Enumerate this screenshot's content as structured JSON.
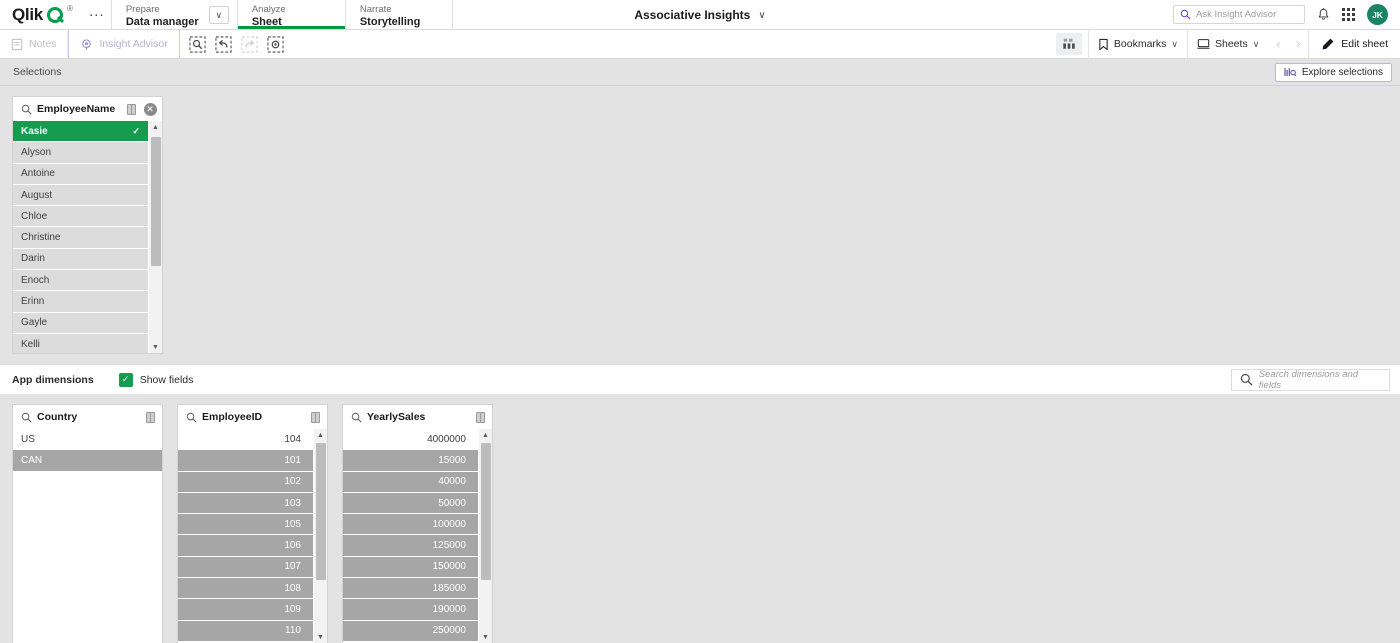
{
  "topbar": {
    "brand": "Qlik",
    "brand_icon": "qlik-logo-icon",
    "overflow_label": "...",
    "tabs": [
      {
        "kicker": "Prepare",
        "title": "Data manager",
        "active": false
      },
      {
        "kicker": "Analyze",
        "title": "Sheet",
        "active": true
      },
      {
        "kicker": "Narrate",
        "title": "Storytelling",
        "active": false
      }
    ],
    "app_title": "Associative Insights",
    "app_title_caret": "∨",
    "search_placeholder": "Ask Insight Advisor",
    "notifications_icon": "bell-icon",
    "apps_icon": "grid-apps-icon",
    "avatar_initials": "JK"
  },
  "toolbar": {
    "notes_label": "Notes",
    "insight_advisor_label": "Insight Advisor",
    "icons": [
      {
        "name": "selection-search-icon",
        "disabled": false
      },
      {
        "name": "step-back-selection-icon",
        "disabled": false
      },
      {
        "name": "step-forward-selection-icon",
        "disabled": true
      },
      {
        "name": "clear-all-selections-icon",
        "disabled": false
      }
    ],
    "data_icon": "data-load-editor-icon",
    "bookmarks_label": "Bookmarks",
    "sheets_label": "Sheets",
    "prev_sheet_icon": "chevron-left-icon",
    "next_sheet_icon": "chevron-right-icon",
    "edit_sheet_label": "Edit sheet",
    "edit_icon": "pencil-icon",
    "caret": "∨"
  },
  "selections_bar": {
    "label": "Selections",
    "explore_label": "Explore selections",
    "explore_icon": "explore-selections-icon"
  },
  "selections": [
    {
      "field": "EmployeeName",
      "search_icon": "search-icon",
      "segment_icon": "listbox-segment-icon",
      "clear_icon": "clear-selection-icon",
      "has_clear": true,
      "align": "left",
      "rows": [
        {
          "value": "Kasie",
          "state": "selected"
        },
        {
          "value": "Alyson",
          "state": "alt"
        },
        {
          "value": "Antoine",
          "state": "alt"
        },
        {
          "value": "August",
          "state": "alt"
        },
        {
          "value": "Chloe",
          "state": "alt"
        },
        {
          "value": "Christine",
          "state": "alt"
        },
        {
          "value": "Darin",
          "state": "alt"
        },
        {
          "value": "Enoch",
          "state": "alt"
        },
        {
          "value": "Erinn",
          "state": "alt"
        },
        {
          "value": "Gayle",
          "state": "alt"
        },
        {
          "value": "Kelli",
          "state": "alt"
        }
      ],
      "scroll": {
        "thumb_top_pct": 2,
        "thumb_height_pct": 62
      }
    }
  ],
  "app_dimensions": {
    "label": "App dimensions",
    "show_fields_label": "Show fields",
    "show_fields_checked": true,
    "check_glyph": "✓",
    "search_placeholder": "Search dimensions and fields",
    "search_icon": "search-icon"
  },
  "fields": [
    {
      "field": "Country",
      "search_icon": "search-icon",
      "segment_icon": "listbox-segment-icon",
      "has_clear": false,
      "align": "left",
      "rows": [
        {
          "value": "US",
          "state": "optional"
        },
        {
          "value": "CAN",
          "state": "excluded"
        }
      ],
      "scroll": null
    },
    {
      "field": "EmployeeID",
      "search_icon": "search-icon",
      "segment_icon": "listbox-segment-icon",
      "has_clear": false,
      "align": "right",
      "rows": [
        {
          "value": "104",
          "state": "optional"
        },
        {
          "value": "101",
          "state": "excluded"
        },
        {
          "value": "102",
          "state": "excluded"
        },
        {
          "value": "103",
          "state": "excluded"
        },
        {
          "value": "105",
          "state": "excluded"
        },
        {
          "value": "106",
          "state": "excluded"
        },
        {
          "value": "107",
          "state": "excluded"
        },
        {
          "value": "108",
          "state": "excluded"
        },
        {
          "value": "109",
          "state": "excluded"
        },
        {
          "value": "110",
          "state": "excluded"
        }
      ],
      "scroll": {
        "thumb_top_pct": 1,
        "thumb_height_pct": 72
      }
    },
    {
      "field": "YearlySales",
      "search_icon": "search-icon",
      "segment_icon": "listbox-segment-icon",
      "has_clear": false,
      "align": "right",
      "rows": [
        {
          "value": "4000000",
          "state": "optional"
        },
        {
          "value": "15000",
          "state": "excluded"
        },
        {
          "value": "40000",
          "state": "excluded"
        },
        {
          "value": "50000",
          "state": "excluded"
        },
        {
          "value": "100000",
          "state": "excluded"
        },
        {
          "value": "125000",
          "state": "excluded"
        },
        {
          "value": "150000",
          "state": "excluded"
        },
        {
          "value": "185000",
          "state": "excluded"
        },
        {
          "value": "190000",
          "state": "excluded"
        },
        {
          "value": "250000",
          "state": "excluded"
        }
      ],
      "scroll": {
        "thumb_top_pct": 1,
        "thumb_height_pct": 72
      }
    }
  ],
  "colors": {
    "selected_green": "#169c4e",
    "excluded_gray": "#a6a6a6",
    "alt_gray": "#dcdcdc",
    "panel_bg": "#e3e3e3",
    "accent_purple": "#bdb6e0",
    "brand_green": "#009845",
    "avatar_bg": "#1a8562"
  }
}
